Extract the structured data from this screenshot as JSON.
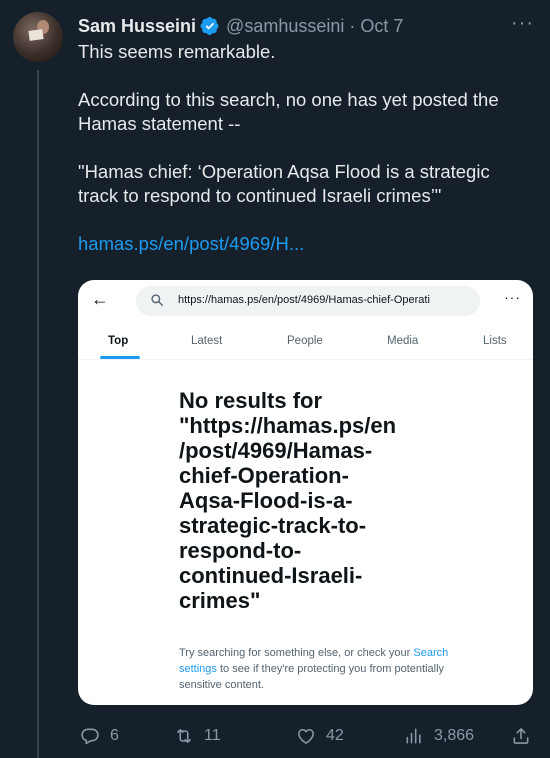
{
  "tweet": {
    "author_name": "Sam Husseini",
    "handle": "@samhusseini",
    "separator": "·",
    "date": "Oct 7",
    "more_label": "···",
    "paragraphs": [
      "This seems remarkable.",
      "According to this search, no one has yet posted the Hamas statement --",
      "\"Hamas chief: ‘Operation Aqsa Flood is a strategic track to respond to continued Israeli crimes’\""
    ],
    "link_text": "hamas.ps/en/post/4969/H..."
  },
  "embedded": {
    "back_label": "←",
    "search_value": "https://hamas.ps/en/post/4969/Hamas-chief-Operati",
    "more_label": "···",
    "tabs": [
      {
        "label": "Top",
        "active": true
      },
      {
        "label": "Latest",
        "active": false
      },
      {
        "label": "People",
        "active": false
      },
      {
        "label": "Media",
        "active": false
      },
      {
        "label": "Lists",
        "active": false
      }
    ],
    "no_results_heading": "No results for \"https://hamas.ps/en/post/4969/Hamas-chief-Operation-Aqsa-Flood-is-a-strategic-track-to-respond-to-continued-Israeli-crimes\"",
    "no_results_lines": [
      "No results for",
      "\"https://hamas.ps/en",
      "/post/4969/Hamas-",
      "chief-Operation-",
      "Aqsa-Flood-is-a-",
      "strategic-track-to-",
      "respond-to-",
      "continued-Israeli-",
      "crimes\""
    ],
    "sub_before": "Try searching for something else, or check your",
    "sub_link": "Search settings",
    "sub_after": "to see if they're protecting you from potentially sensitive content."
  },
  "actions": {
    "replies": "6",
    "retweets": "11",
    "likes": "42",
    "views": "3,866"
  },
  "colors": {
    "background": "#15202b",
    "accent": "#1d9bf0",
    "muted": "#8b98a5"
  },
  "icons": [
    "verified-badge-icon",
    "reply-icon",
    "retweet-icon",
    "like-icon",
    "views-icon",
    "share-icon",
    "search-icon",
    "back-arrow-icon"
  ]
}
